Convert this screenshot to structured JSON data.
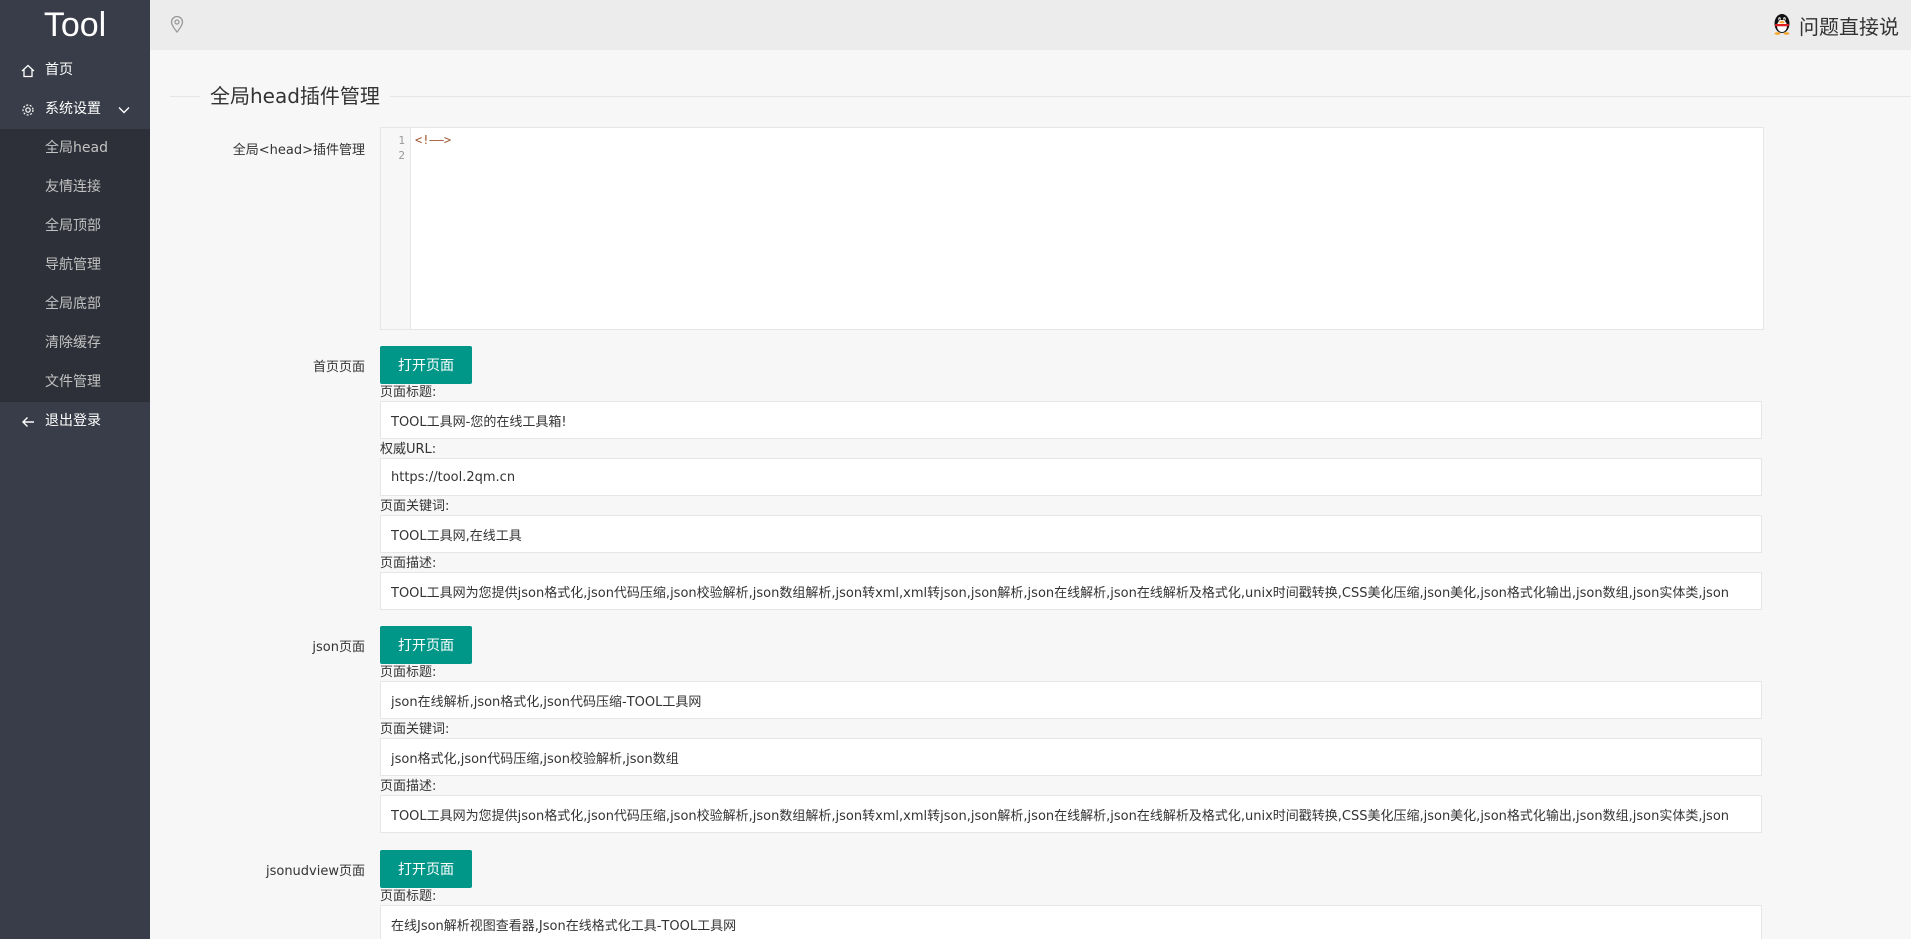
{
  "sidebar": {
    "logo": "Tool",
    "home": "首页",
    "settings": "系统设置",
    "subitems": [
      "全局head",
      "友情连接",
      "全局顶部",
      "导航管理",
      "全局底部",
      "清除缓存",
      "文件管理"
    ],
    "logout": "退出登录"
  },
  "topbar": {
    "user_link": "问题直接说"
  },
  "main": {
    "legend": "全局head插件管理",
    "head_label": "全局<head>插件管理",
    "editor": {
      "lines": [
        "1",
        "2"
      ],
      "code": "<!——>"
    },
    "open_button": "打开页面",
    "sections": [
      {
        "label": "首页页面",
        "fields": [
          {
            "label": "页面标题:",
            "value": "TOOL工具网-您的在线工具箱!"
          },
          {
            "label": "权威URL:",
            "value": "https://tool.2qm.cn"
          },
          {
            "label": "页面关键词:",
            "value": "TOOL工具网,在线工具"
          },
          {
            "label": "页面描述:",
            "value": "TOOL工具网为您提供json格式化,json代码压缩,json校验解析,json数组解析,json转xml,xml转json,json解析,json在线解析,json在线解析及格式化,unix时间戳转换,CSS美化压缩,json美化,json格式化输出,json数组,json实体类,json"
          }
        ]
      },
      {
        "label": "json页面",
        "fields": [
          {
            "label": "页面标题:",
            "value": "json在线解析,json格式化,json代码压缩-TOOL工具网"
          },
          {
            "label": "页面关键词:",
            "value": "json格式化,json代码压缩,json校验解析,json数组"
          },
          {
            "label": "页面描述:",
            "value": "TOOL工具网为您提供json格式化,json代码压缩,json校验解析,json数组解析,json转xml,xml转json,json解析,json在线解析,json在线解析及格式化,unix时间戳转换,CSS美化压缩,json美化,json格式化输出,json数组,json实体类,json"
          }
        ]
      },
      {
        "label": "jsonudview页面",
        "fields": [
          {
            "label": "页面标题:",
            "value": "在线Json解析视图查看器,Json在线格式化工具-TOOL工具网"
          }
        ]
      }
    ]
  }
}
